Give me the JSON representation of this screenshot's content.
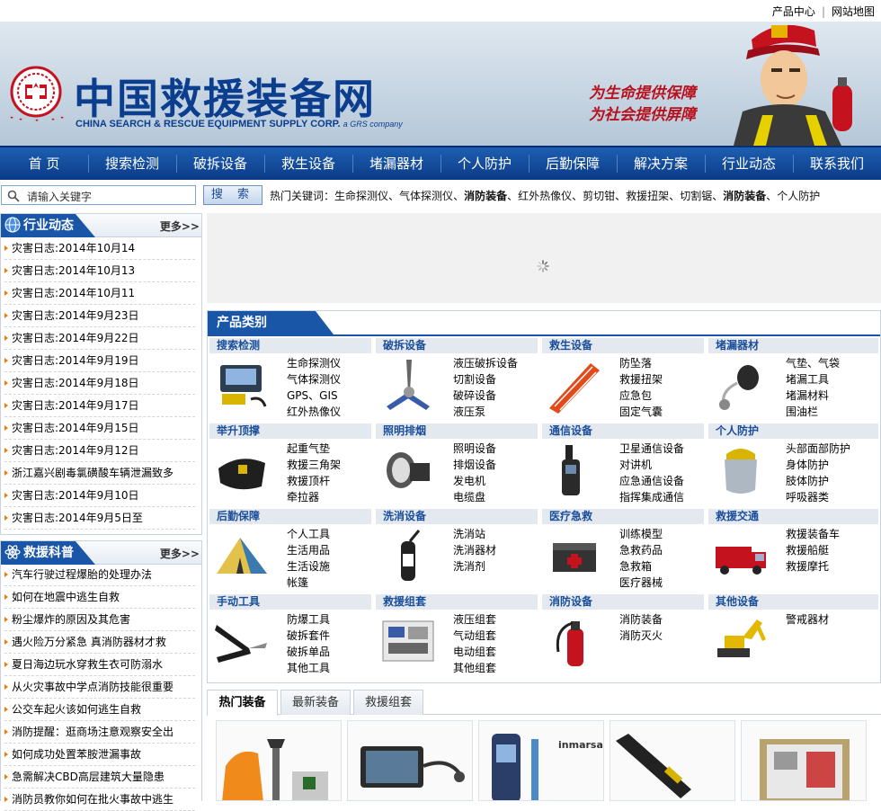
{
  "toplinks": {
    "product_center": "产品中心",
    "sep": "|",
    "sitemap": "网站地图"
  },
  "header": {
    "title": "中国救援装备网",
    "subtitle": "CHINA SEARCH & RESCUE EQUIPMENT SUPPLY CORP.",
    "subtitle_small": "a GRS company",
    "slogan_line1": "为生命提供保障",
    "slogan_line2": "为社会提供屏障"
  },
  "nav": [
    "首 页",
    "搜索检测",
    "破拆设备",
    "救生设备",
    "堵漏器材",
    "个人防护",
    "后勤保障",
    "解决方案",
    "行业动态",
    "联系我们"
  ],
  "search": {
    "placeholder": "请输入关键字",
    "button": "搜 索"
  },
  "hot_keywords": {
    "label": "热门关键词：",
    "items": [
      {
        "text": "生命探测仪",
        "bold": false
      },
      {
        "text": "气体探测仪",
        "bold": false
      },
      {
        "text": "消防装备",
        "bold": true
      },
      {
        "text": "红外热像仪",
        "bold": false
      },
      {
        "text": "剪切钳",
        "bold": false
      },
      {
        "text": "救援扭架",
        "bold": false
      },
      {
        "text": "切割锯",
        "bold": false
      },
      {
        "text": "消防装备",
        "bold": true
      },
      {
        "text": "个人防护",
        "bold": false
      }
    ]
  },
  "industry_news": {
    "title": "行业动态",
    "more": "更多>>",
    "items": [
      "灾害日志:2014年10月14",
      "灾害日志:2014年10月13",
      "灾害日志:2014年10月11",
      "灾害日志:2014年9月23日",
      "灾害日志:2014年9月22日",
      "灾害日志:2014年9月19日",
      "灾害日志:2014年9月18日",
      "灾害日志:2014年9月17日",
      "灾害日志:2014年9月15日",
      "灾害日志:2014年9月12日",
      "浙江嘉兴剧毒氯磺酸车辆泄漏致多",
      "灾害日志:2014年9月10日",
      "灾害日志:2014年9月5日至"
    ]
  },
  "rescue_science": {
    "title": "救援科普",
    "more": "更多>>",
    "items": [
      "汽车行驶过程爆胎的处理办法",
      "如何在地震中逃生自救",
      "粉尘爆炸的原因及其危害",
      "遇火险万分紧急 真消防器材才救",
      "夏日海边玩水穿救生衣可防溺水",
      "从火灾事故中学点消防技能很重要",
      "公交车起火该如何逃生自救",
      "消防提醒：逛商场注意观察安全出",
      "如何成功处置苯胺泄漏事故",
      "急需解决CBD高层建筑大量隐患",
      "消防员教你如何在批火事故中逃生"
    ]
  },
  "product_categories": {
    "title": "产品类别",
    "groups": [
      {
        "name": "搜索检测",
        "icon": "detector-case-icon",
        "items": [
          "生命探测仪",
          "气体探测仪",
          "GPS、GIS",
          "红外热像仪"
        ]
      },
      {
        "name": "破拆设备",
        "icon": "hydraulic-spreader-icon",
        "items": [
          "液压破拆设备",
          "切割设备",
          "破碎设备",
          "液压泵"
        ]
      },
      {
        "name": "救生设备",
        "icon": "rescue-stretcher-icon",
        "items": [
          "防坠落",
          "救援扭架",
          "应急包",
          "固定气囊"
        ]
      },
      {
        "name": "堵漏器材",
        "icon": "leak-plug-icon",
        "items": [
          "气垫、气袋",
          "堵漏工具",
          "堵漏材料",
          "围油栏"
        ]
      },
      {
        "name": "举升顶撑",
        "icon": "lifting-bag-icon",
        "items": [
          "起重气垫",
          "救援三角架",
          "救援顶杆",
          "牵拉器"
        ]
      },
      {
        "name": "照明排烟",
        "icon": "searchlight-icon",
        "items": [
          "照明设备",
          "排烟设备",
          "发电机",
          "电缆盘"
        ]
      },
      {
        "name": "通信设备",
        "icon": "satellite-phone-icon",
        "items": [
          "卫星通信设备",
          "对讲机",
          "应急通信设备",
          "指挥集成通信"
        ]
      },
      {
        "name": "个人防护",
        "icon": "face-shield-icon",
        "items": [
          "头部面部防护",
          "身体防护",
          "肢体防护",
          "呼吸器类"
        ]
      },
      {
        "name": "后勤保障",
        "icon": "tent-icon",
        "items": [
          "个人工具",
          "生活用品",
          "生活设施",
          "帐篷"
        ]
      },
      {
        "name": "洗消设备",
        "icon": "sprayer-icon",
        "items": [
          "洗消站",
          "洗消器材",
          "洗消剂"
        ]
      },
      {
        "name": "医疗急救",
        "icon": "first-aid-box-icon",
        "items": [
          "训练模型",
          "急救药品",
          "急救箱",
          "医疗器械"
        ]
      },
      {
        "name": "救援交通",
        "icon": "fire-truck-icon",
        "items": [
          "救援装备车",
          "救援船艇",
          "救援摩托"
        ]
      },
      {
        "name": "手动工具",
        "icon": "bolt-cutter-icon",
        "items": [
          "防爆工具",
          "破拆套件",
          "破拆单品",
          "其他工具"
        ]
      },
      {
        "name": "救援组套",
        "icon": "tool-set-icon",
        "items": [
          "液压组套",
          "气动组套",
          "电动组套",
          "其他组套"
        ]
      },
      {
        "name": "消防设备",
        "icon": "fire-extinguisher-icon",
        "items": [
          "消防装备",
          "消防灭火"
        ]
      },
      {
        "name": "其他设备",
        "icon": "excavator-icon",
        "items": [
          "警戒器材"
        ]
      }
    ]
  },
  "bottom_tabs": [
    "热门装备",
    "最新装备",
    "救援组套"
  ],
  "products": [
    {
      "icon": "rescue-kit-icon",
      "brand": ""
    },
    {
      "icon": "inspection-camera-icon",
      "brand": ""
    },
    {
      "icon": "satellite-handset-icon",
      "brand": "inmarsat"
    },
    {
      "icon": "metal-detector-icon",
      "brand": ""
    },
    {
      "icon": "equipment-case-icon",
      "brand": ""
    }
  ],
  "colors": {
    "primary_blue": "#1a56a8",
    "nav_top": "#1e5fb2",
    "nav_bottom": "#0b3a86",
    "accent_orange": "#f07d00",
    "slogan_red": "#b8111e"
  }
}
